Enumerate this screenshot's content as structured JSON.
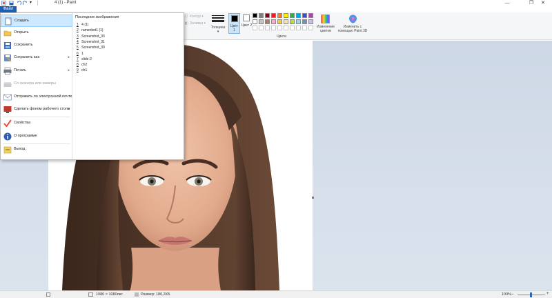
{
  "window": {
    "title": "4 (1) - Paint",
    "qa_dropdown": "▾"
  },
  "ribbon": {
    "file_tab": "Файл",
    "contour": "Контур",
    "fill": "Заливка",
    "thickness": "Толщина",
    "color1": "Цвет 1",
    "color2": "Цвет 2",
    "edit_colors": "Изменение цветов",
    "paint3d": "Изменить с помощью Paint 3D",
    "colors_group": "Цвета",
    "palette_row1": [
      "#000000",
      "#7f7f7f",
      "#880015",
      "#ed1c24",
      "#ff7f27",
      "#fff200",
      "#22b14c",
      "#00a2e8",
      "#3f48cc",
      "#a349a4"
    ],
    "palette_row2": [
      "#ffffff",
      "#c3c3c3",
      "#b97a57",
      "#ffaec9",
      "#ffc90e",
      "#efe4b0",
      "#b5e61d",
      "#99d9ea",
      "#7092be",
      "#c8bfe7"
    ]
  },
  "file_menu": {
    "items": [
      {
        "label": "Создать",
        "icon": "new-file-icon",
        "has_arrow": false,
        "disabled": false
      },
      {
        "label": "Открыть",
        "icon": "open-folder-icon",
        "has_arrow": false,
        "disabled": false
      },
      {
        "label": "Сохранить",
        "icon": "save-icon",
        "has_arrow": false,
        "disabled": false
      },
      {
        "label": "Сохранить как",
        "icon": "save-as-icon",
        "has_arrow": true,
        "disabled": false
      },
      {
        "label": "Печать",
        "icon": "printer-icon",
        "has_arrow": true,
        "disabled": false
      },
      {
        "label": "Со сканера или камеры",
        "icon": "scanner-icon",
        "has_arrow": false,
        "disabled": true
      },
      {
        "label": "Отправить по электронной почте",
        "icon": "email-icon",
        "has_arrow": false,
        "disabled": false
      },
      {
        "label": "Сделать фоном рабочего стола",
        "icon": "desktop-background-icon",
        "has_arrow": true,
        "disabled": false
      },
      {
        "label": "Свойства",
        "icon": "checkmark-icon",
        "has_arrow": false,
        "disabled": false
      },
      {
        "label": "О программе",
        "icon": "info-icon",
        "has_arrow": false,
        "disabled": false
      },
      {
        "label": "Выход",
        "icon": "exit-icon",
        "has_arrow": false,
        "disabled": false
      }
    ],
    "recent_title": "Последние изображения",
    "recent": [
      {
        "num": "1",
        "name": "4 (1)"
      },
      {
        "num": "2",
        "name": "ramenbet1 (1)"
      },
      {
        "num": "3",
        "name": "Screenshot_33"
      },
      {
        "num": "4",
        "name": "Screenshot_31"
      },
      {
        "num": "5",
        "name": "Screenshot_30"
      },
      {
        "num": "6",
        "name": "1"
      },
      {
        "num": "7",
        "name": "slide-2"
      },
      {
        "num": "8",
        "name": "ch2"
      },
      {
        "num": "9",
        "name": "ch1"
      }
    ]
  },
  "status": {
    "dimensions": "1080 × 1080пкс",
    "size": "Размер: 180,2КБ",
    "zoom": "100%"
  }
}
